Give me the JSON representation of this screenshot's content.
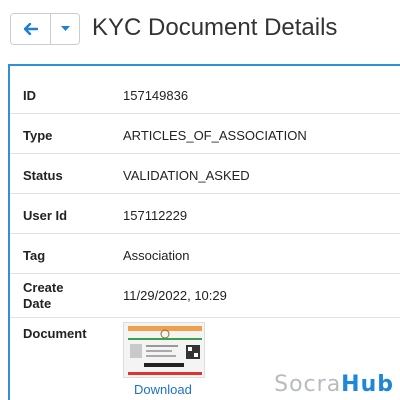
{
  "header": {
    "title": "KYC Document Details",
    "back_icon": "arrow-left-icon",
    "dropdown_icon": "caret-down-icon"
  },
  "details": {
    "id": {
      "label": "ID",
      "value": "157149836"
    },
    "type": {
      "label": "Type",
      "value": "ARTICLES_OF_ASSOCIATION"
    },
    "status": {
      "label": "Status",
      "value": "VALIDATION_ASKED"
    },
    "user_id": {
      "label": "User Id",
      "value": "157112229"
    },
    "tag": {
      "label": "Tag",
      "value": "Association"
    },
    "create_date": {
      "label": "Create Date",
      "value": "11/29/2022, 10:29"
    },
    "document": {
      "label": "Document",
      "download_label": "Download"
    }
  },
  "watermark": {
    "part1": "Socra",
    "part2": "Hub"
  },
  "colors": {
    "accent": "#2f8fd8",
    "link": "#1a73c8",
    "brand_blue": "#1e88d8",
    "brand_gray": "#b7bcc2"
  }
}
